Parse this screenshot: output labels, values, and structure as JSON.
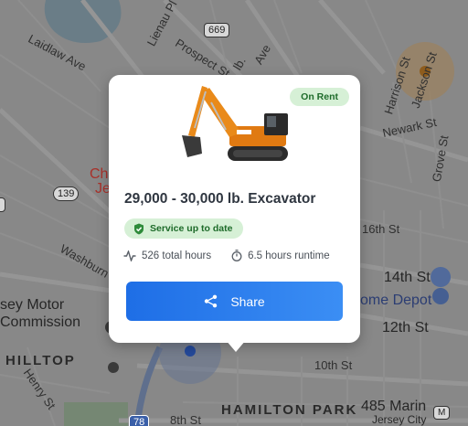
{
  "map": {
    "streets": {
      "laidlaw": "Laidlaw Ave",
      "lienau": "Lienau Pl",
      "prospect": "Prospect St",
      "ave": "Ave",
      "harrison": "Harrison St",
      "jackson": "Jackson St",
      "newark": "Newark St",
      "grove": "Grove St",
      "washburn": "Washburn St",
      "sixteenth": "16th St",
      "fourteenth": "14th St",
      "twelfth": "12th St",
      "tenth": "10th St",
      "eighth": "8th St",
      "henry": "Henry St",
      "lb": "lb."
    },
    "routes": {
      "r669": "669",
      "r139": "139",
      "r78": "78"
    },
    "places": {
      "ch": "Ch",
      "je": "Je",
      "motor_line1": "sey Motor",
      "motor_line2": "Commission",
      "home_depot": "ome Depot",
      "marin_line1": "485 Marin",
      "marin_line2": "Jersey City",
      "hilltop": "HILLTOP",
      "hamilton_park": "HAMILTON PARK",
      "small_m": "M"
    }
  },
  "popup": {
    "status_badge": "On Rent",
    "title": "29,000 - 30,000 lb. Excavator",
    "service_badge": "Service up to date",
    "total_hours": "526 total hours",
    "runtime": "6.5 hours runtime",
    "share_label": "Share",
    "image_icon": "excavator-image",
    "colors": {
      "accent": "#1e6ee6",
      "badge_bg": "#d6f0d6",
      "badge_text": "#1e6b2a"
    }
  }
}
